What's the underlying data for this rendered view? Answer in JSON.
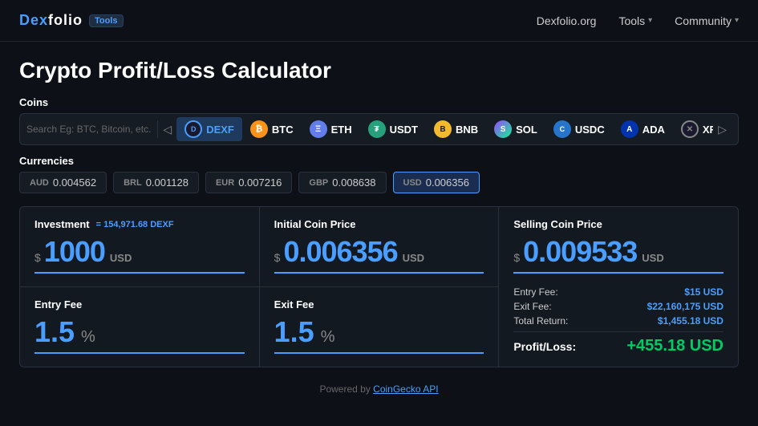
{
  "header": {
    "logo": "Dexfolio",
    "logo_dex": "Dex",
    "logo_folio": "folio",
    "tools_badge": "Tools",
    "nav": [
      {
        "label": "Dexfolio.org",
        "has_arrow": false
      },
      {
        "label": "Tools",
        "has_arrow": true
      },
      {
        "label": "Community",
        "has_arrow": true
      }
    ]
  },
  "page": {
    "title": "Crypto Profit/Loss Calculator"
  },
  "coins_section": {
    "label": "Coins",
    "search_placeholder": "Search Eg: BTC, Bitcoin, etc.",
    "coins": [
      {
        "symbol": "DEXF",
        "icon_class": "icon-dexf",
        "icon_text": "D",
        "active": true
      },
      {
        "symbol": "BTC",
        "icon_class": "icon-btc",
        "icon_text": "₿",
        "active": false
      },
      {
        "symbol": "ETH",
        "icon_class": "icon-eth",
        "icon_text": "Ξ",
        "active": false
      },
      {
        "symbol": "USDT",
        "icon_class": "icon-usdt",
        "icon_text": "₮",
        "active": false
      },
      {
        "symbol": "BNB",
        "icon_class": "icon-bnb",
        "icon_text": "B",
        "active": false
      },
      {
        "symbol": "SOL",
        "icon_class": "icon-sol",
        "icon_text": "S",
        "active": false
      },
      {
        "symbol": "USDC",
        "icon_class": "icon-usdc",
        "icon_text": "C",
        "active": false
      },
      {
        "symbol": "ADA",
        "icon_class": "icon-ada",
        "icon_text": "A",
        "active": false
      },
      {
        "symbol": "XRP",
        "icon_class": "icon-xrp",
        "icon_text": "✕",
        "active": false
      }
    ]
  },
  "currencies_section": {
    "label": "Currencies",
    "currencies": [
      {
        "code": "AUD",
        "value": "0.004562",
        "active": false
      },
      {
        "code": "BRL",
        "value": "0.001128",
        "active": false
      },
      {
        "code": "EUR",
        "value": "0.007216",
        "active": false
      },
      {
        "code": "GBP",
        "value": "0.008638",
        "active": false
      },
      {
        "code": "USD",
        "value": "0.006356",
        "active": true
      }
    ]
  },
  "calculator": {
    "investment": {
      "label": "Investment",
      "sublabel": "= 154,971.68 DEXF",
      "currency_sign": "$",
      "value": "1000",
      "unit": "USD"
    },
    "initial_price": {
      "label": "Initial Coin Price",
      "currency_sign": "$",
      "value": "0.006356",
      "unit": "USD"
    },
    "entry_fee": {
      "label": "Entry Fee",
      "value": "1.5",
      "unit": "%"
    },
    "exit_fee": {
      "label": "Exit Fee",
      "value": "1.5",
      "unit": "%"
    },
    "selling_price": {
      "label": "Selling Coin Price",
      "currency_sign": "$",
      "value": "0.009533",
      "unit": "USD"
    },
    "results": {
      "entry_fee_label": "Entry Fee:",
      "entry_fee_value": "$15 USD",
      "exit_fee_label": "Exit Fee:",
      "exit_fee_value": "$22,160,175 USD",
      "total_return_label": "Total Return:",
      "total_return_value": "$1,455.18 USD",
      "profit_loss_label": "Profit/Loss:",
      "profit_loss_value": "+455.18 USD"
    }
  },
  "footer": {
    "text": "Powered by ",
    "link_text": "CoinGecko API"
  }
}
